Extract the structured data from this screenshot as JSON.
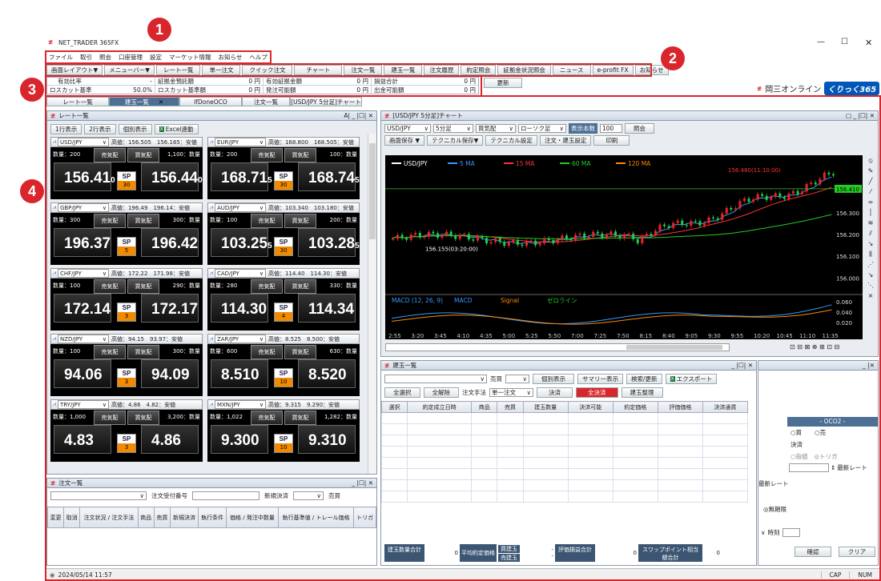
{
  "app": {
    "title": "NET_TRADER 365FX",
    "status_time": "2024/05/14 11:57",
    "caps": [
      "CAP",
      "NUM"
    ],
    "brand": "岡三オンライン",
    "brand_logo": "くりっく365"
  },
  "menu": [
    "ファイル",
    "取引",
    "照会",
    "口座管理",
    "設定",
    "マーケット情報",
    "お知らせ",
    "ヘルプ"
  ],
  "toolbar": [
    "画面レイアウト▼",
    "メニューバー▼",
    "レート一覧",
    "単一注文",
    "クイック注文",
    "チャート",
    "注文一覧",
    "建玉一覧",
    "注文履歴",
    "約定照会",
    "証拠金状況照会",
    "ニュース",
    "e-profit FX",
    "お知らせ"
  ],
  "account": {
    "rows": [
      [
        [
          "有効比率",
          "-"
        ],
        [
          "証拠金預託額",
          "0 円"
        ],
        [
          "有効証拠金額",
          "0 円"
        ],
        [
          "損益合計",
          "0 円"
        ]
      ],
      [
        [
          "ロスカット基準",
          "50.0%"
        ],
        [
          "ロスカット基準額",
          "0 円"
        ],
        [
          "発注可能額",
          "0 円"
        ],
        [
          "出金可能額",
          "0 円"
        ]
      ]
    ],
    "update": "更新"
  },
  "tabs": [
    "レート一覧",
    "建玉一覧",
    "IfDoneOCO",
    "注文一覧",
    "[USD/JPY 5分足]チャート"
  ],
  "callouts": [
    "1",
    "2",
    "3",
    "4"
  ],
  "rates": {
    "title": "レート一覧",
    "buttons": [
      "1行表示",
      "2行表示",
      "個別表示",
      "Excel連動"
    ],
    "cards": [
      {
        "pair": "USD/JPY",
        "hl": "高値：156.505　156.165：安値",
        "qtyL": "数量：200",
        "qtyR": "1,100：数量",
        "bid": "156.41",
        "bidS": "0",
        "ask": "156.44",
        "askS": "0",
        "sp": "30"
      },
      {
        "pair": "EUR/JPY",
        "hl": "高値：168.800　168.505：安値",
        "qtyL": "数量：200",
        "qtyR": "100：数量",
        "bid": "168.71",
        "bidS": "5",
        "ask": "168.74",
        "askS": "5",
        "sp": "30"
      },
      {
        "pair": "GBP/JPY",
        "hl": "高値：196.49　196.14：安値",
        "qtyL": "数量：300",
        "qtyR": "300：数量",
        "bid": "196.37",
        "bidS": "",
        "ask": "196.42",
        "askS": "",
        "sp": "5"
      },
      {
        "pair": "AUD/JPY",
        "hl": "高値：103.340　103.180：安値",
        "qtyL": "数量：100",
        "qtyR": "200：数量",
        "bid": "103.25",
        "bidS": "5",
        "ask": "103.28",
        "askS": "5",
        "sp": "30"
      },
      {
        "pair": "CHF/JPY",
        "hl": "高値：172.22　171.98：安値",
        "qtyL": "数量：100",
        "qtyR": "290：数量",
        "bid": "172.14",
        "bidS": "",
        "ask": "172.17",
        "askS": "",
        "sp": "3"
      },
      {
        "pair": "CAD/JPY",
        "hl": "高値：114.40　114.30：安値",
        "qtyL": "数量：280",
        "qtyR": "330：数量",
        "bid": "114.30",
        "bidS": "",
        "ask": "114.34",
        "askS": "",
        "sp": "4"
      },
      {
        "pair": "NZD/JPY",
        "hl": "高値：94.15　93.97：安値",
        "qtyL": "数量：100",
        "qtyR": "300：数量",
        "bid": "94.06",
        "bidS": "",
        "ask": "94.09",
        "askS": "",
        "sp": "3"
      },
      {
        "pair": "ZAR/JPY",
        "hl": "高値：8.525　8.500：安値",
        "qtyL": "数量：600",
        "qtyR": "630：数量",
        "bid": "8.510",
        "bidS": "",
        "ask": "8.520",
        "askS": "",
        "sp": "10"
      },
      {
        "pair": "TRY/JPY",
        "hl": "高値：4.86　4.82：安値",
        "qtyL": "数量：1,000",
        "qtyR": "3,200：数量",
        "bid": "4.83",
        "bidS": "",
        "ask": "4.86",
        "askS": "",
        "sp": "3"
      },
      {
        "pair": "MXN/JPY",
        "hl": "高値：9.315　9.290：安値",
        "qtyL": "数量：1,022",
        "qtyR": "1,282：数量",
        "bid": "9.300",
        "bidS": "",
        "ask": "9.310",
        "askS": "",
        "sp": "10"
      }
    ],
    "sell": "売気配",
    "buy": "買気配",
    "sp": "SP"
  },
  "orders": {
    "title": "注文一覧",
    "label": "注文受付番号",
    "new": "新規決済",
    "side": "売買",
    "cols": [
      "変更",
      "取消",
      "注文状況 / 注文手法",
      "商品",
      "売買",
      "新規決済",
      "執行条件",
      "価格 / 発注中数量",
      "執行基準値 / トレール価格",
      "トリガ"
    ]
  },
  "chart": {
    "title": "[USD/JPY 5分足]チャート",
    "pair": "USD/JPY",
    "tf": "5分足",
    "quote": "買気配",
    "candle": "ローソク足",
    "bars_label": "表示本数",
    "bars": "100",
    "show": "照会",
    "buttons": [
      "画面保存 ▼",
      "テクニカル保存▼",
      "テクニカル設定",
      "注文・建玉設定",
      "印刷"
    ],
    "legend": [
      "USD/JPY",
      "5 MA",
      "15 MA",
      "60 MA",
      "120 MA"
    ],
    "hi_label": "156.480(11:10:00)",
    "lo_label": "156.155(03:20:00)",
    "last": "156.410",
    "yticks": [
      "156.300",
      "156.200",
      "156.100",
      "156.000"
    ],
    "macd_legend": [
      "MACD (12, 26, 9)",
      "MACD",
      "Signal",
      "ゼロライン"
    ],
    "macd_ticks": [
      "0.060",
      "0.040",
      "0.020"
    ],
    "xticks": [
      "2:55",
      "3:20",
      "3:45",
      "4:10",
      "4:35",
      "5:00",
      "5:25",
      "5:50",
      "7:00",
      "7:25",
      "7:50",
      "8:15",
      "8:40",
      "9:05",
      "9:30",
      "9:55",
      "10:20",
      "10:45",
      "11:10",
      "11:35"
    ]
  },
  "positions": {
    "title": "建玉一覧",
    "side": "売買",
    "btns": [
      "個別表示",
      "サマリー表示",
      "検索/更新",
      "エクスポート"
    ],
    "btns2": [
      "全選択",
      "全解除",
      "注文手法",
      "単一注文",
      "決済",
      "全決済",
      "建玉整理"
    ],
    "cols": [
      "選択",
      "約定成立日時",
      "商品",
      "売買",
      "建玉数量",
      "決済可能",
      "約定価格",
      "評価価格",
      "決済通貨"
    ],
    "footer": [
      "建玉数量合計",
      "0",
      "平均約定価格",
      "買建玉",
      "売建玉",
      "-",
      "-",
      "評価損益合計",
      "0",
      "スワップポイント相当額合計",
      "0"
    ]
  },
  "ifdone": {
    "tab": "- OCO2 -",
    "buy": "○買",
    "sell": "○売",
    "settle": "決済",
    "limit": "○指値",
    "stop": "◎トリガ",
    "latest": "最新レート",
    "latest2": "最新レート",
    "nolimit": "◎無期限",
    "time": "時刻",
    "confirm": "確認",
    "clear": "クリア"
  }
}
